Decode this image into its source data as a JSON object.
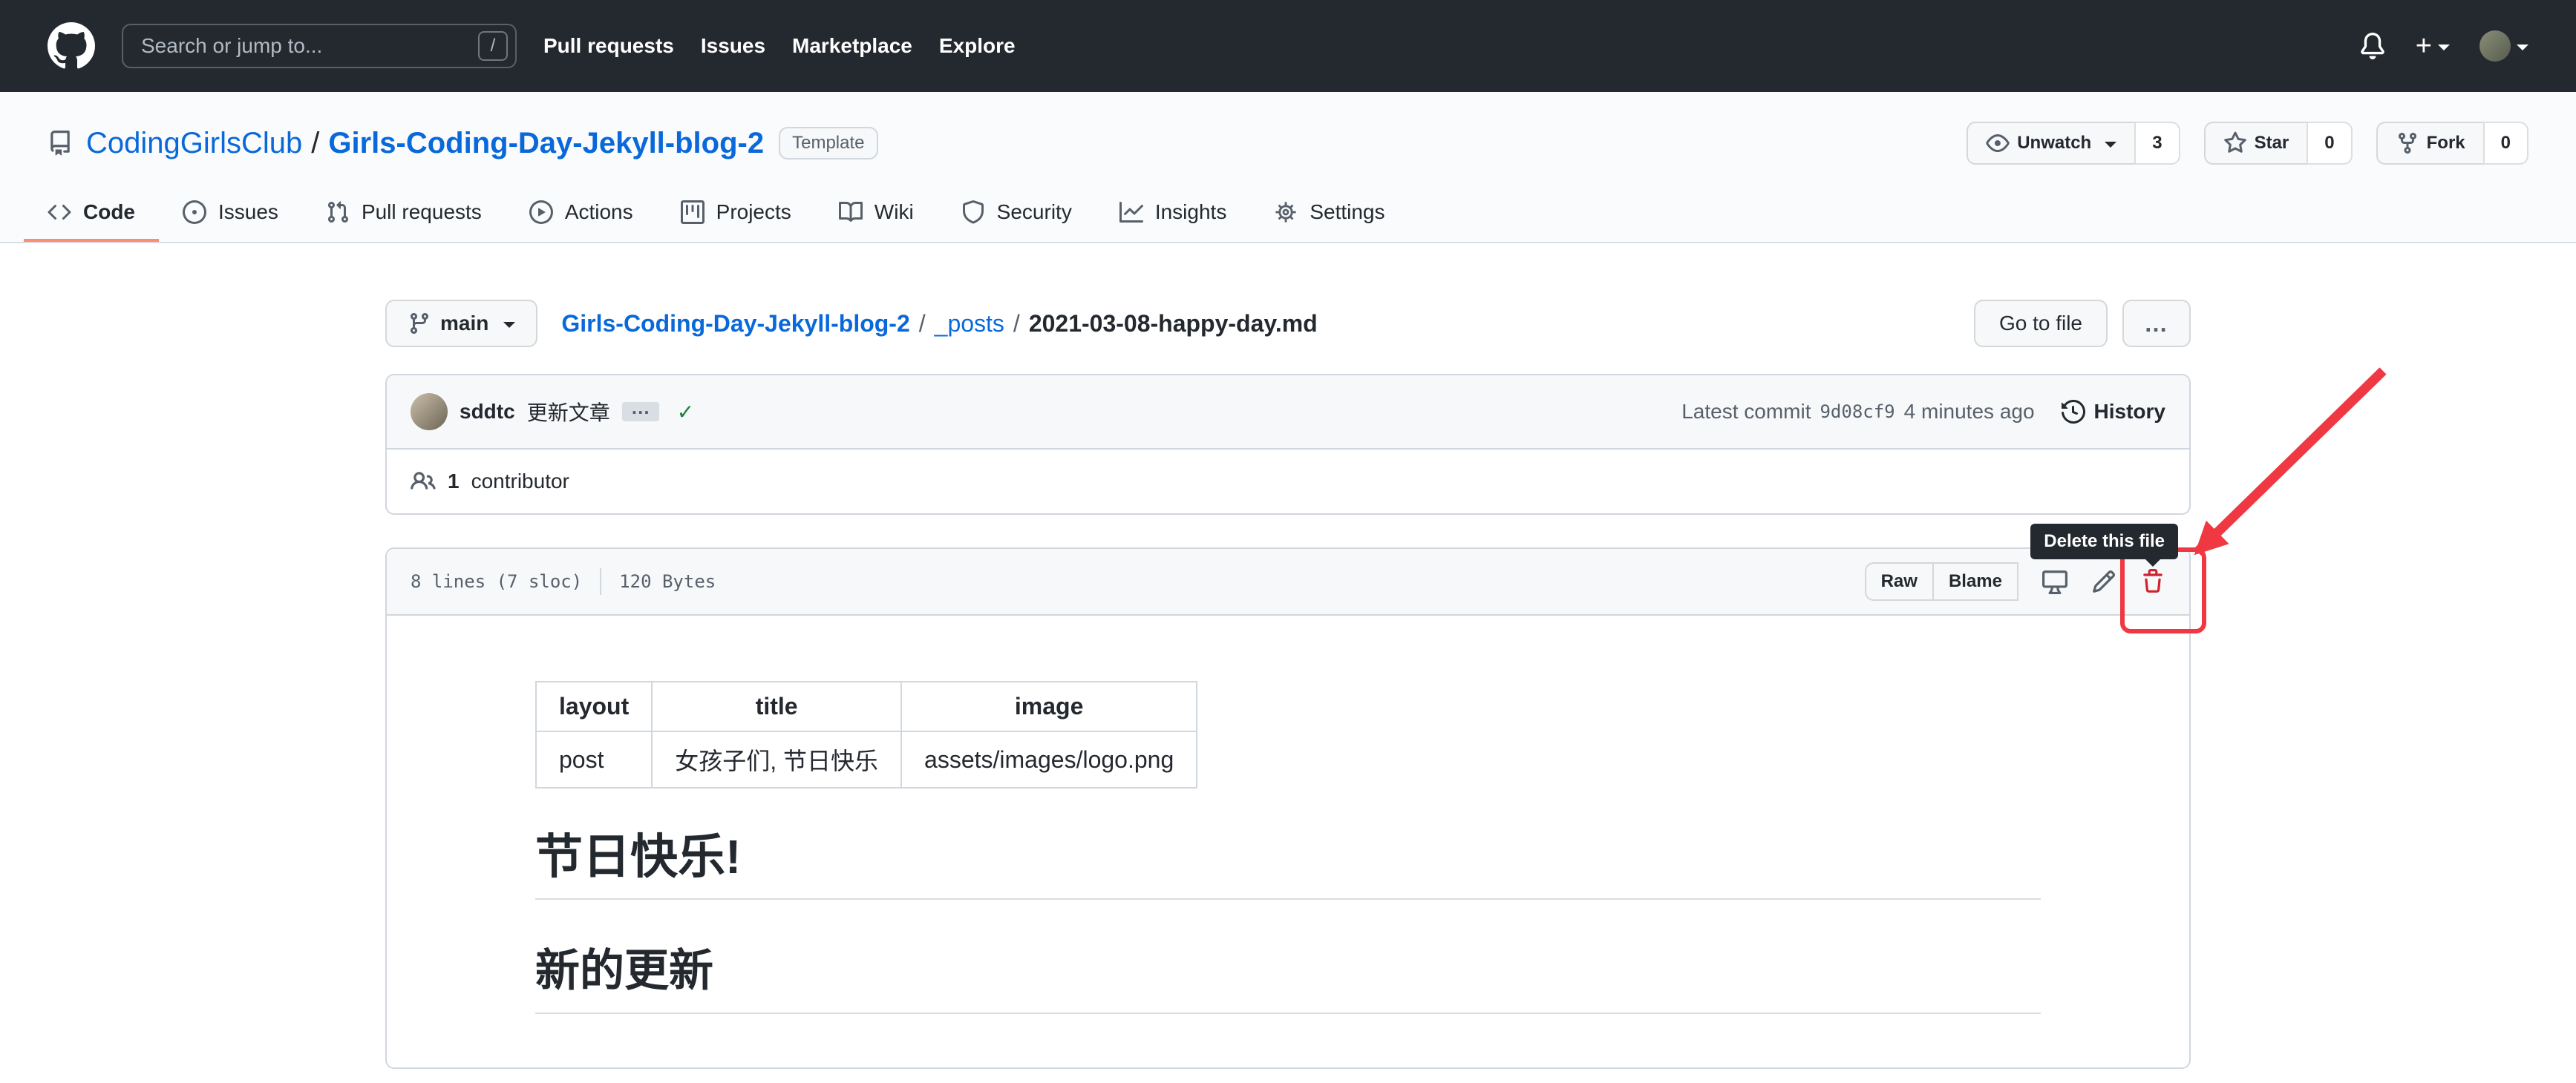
{
  "header": {
    "search": {
      "placeholder": "Search or jump to...",
      "shortcut": "/"
    },
    "nav": [
      "Pull requests",
      "Issues",
      "Marketplace",
      "Explore"
    ]
  },
  "repo": {
    "owner": "CodingGirlsClub",
    "separator": "/",
    "name": "Girls-Coding-Day-Jekyll-blog-2",
    "template_badge": "Template",
    "actions": {
      "unwatch": "Unwatch",
      "unwatch_count": "3",
      "star": "Star",
      "star_count": "0",
      "fork": "Fork",
      "fork_count": "0"
    },
    "tabs": [
      {
        "label": "Code",
        "active": true
      },
      {
        "label": "Issues"
      },
      {
        "label": "Pull requests"
      },
      {
        "label": "Actions"
      },
      {
        "label": "Projects"
      },
      {
        "label": "Wiki"
      },
      {
        "label": "Security"
      },
      {
        "label": "Insights"
      },
      {
        "label": "Settings"
      }
    ]
  },
  "file_nav": {
    "branch": "main",
    "breadcrumb": {
      "repo": "Girls-Coding-Day-Jekyll-blog-2",
      "separator": "/",
      "dir": "_posts",
      "file": "2021-03-08-happy-day.md"
    },
    "go_to_file": "Go to file",
    "kebab": "…"
  },
  "commit": {
    "author": "sddtc",
    "message": "更新文章",
    "ellipsis": "…",
    "check": "✓",
    "latest_label": "Latest commit",
    "hash": "9d08cf9",
    "time": "4 minutes ago",
    "history": "History",
    "contributors_count": "1",
    "contributors_label": "contributor"
  },
  "file": {
    "lines_info": "8 lines (7 sloc)",
    "size_info": "120 Bytes",
    "raw": "Raw",
    "blame": "Blame"
  },
  "markdown": {
    "table": {
      "headers": [
        "layout",
        "title",
        "image"
      ],
      "rows": [
        [
          "post",
          "女孩子们, 节日快乐",
          "assets/images/logo.png"
        ]
      ]
    },
    "headings": [
      "节日快乐!",
      "新的更新"
    ]
  },
  "annotations": {
    "tooltip": "Delete this file",
    "highlight_color": "#ef3842"
  },
  "colors": {
    "header_bg": "#24292f",
    "link_blue": "#0969da",
    "tab_accent_orange": "#fd8c73",
    "box_header_bg": "#f6f8fa",
    "border": "#d0d7de",
    "muted_text": "#57606a",
    "success_green": "#1a7f37",
    "danger_red": "#cf222e",
    "annotation_red": "#ef3842"
  },
  "icons": {
    "github-logo": "github-mark",
    "search-slash": "/",
    "bell": "notifications",
    "plus": "+",
    "caret": "▾",
    "repo": "repo-book",
    "eye": "unwatch",
    "star": "star",
    "fork": "repo-forked",
    "code": "</>",
    "issue": "issue-opened",
    "pull-request": "git-pull-request",
    "actions": "play-circle",
    "projects": "project-board",
    "wiki": "book",
    "security": "shield",
    "insights": "graph",
    "settings": "gear",
    "branch": "git-branch",
    "history": "clock",
    "contributors": "people",
    "display": "device-desktop",
    "edit": "pencil",
    "delete": "trash"
  }
}
